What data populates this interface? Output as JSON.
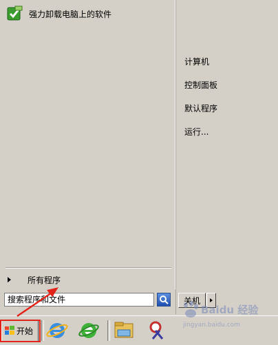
{
  "start_menu": {
    "pinned_items": [
      {
        "label": "强力卸载电脑上的软件",
        "icon": "uninstaller-app-icon"
      }
    ],
    "places": [
      {
        "label": "计算机"
      },
      {
        "label": "控制面板"
      },
      {
        "label": "默认程序"
      },
      {
        "label": "运行..."
      }
    ],
    "all_programs_label": "所有程序",
    "search": {
      "placeholder": "搜索程序和文件"
    },
    "shutdown_label": "关机"
  },
  "taskbar": {
    "start_label": "开始",
    "pinned_apps": [
      {
        "icon": "internet-explorer-icon"
      },
      {
        "icon": "green-browser-icon"
      },
      {
        "icon": "file-explorer-icon"
      },
      {
        "icon": "snipping-tool-icon"
      }
    ]
  },
  "annotation": {
    "highlight_color": "#e2231a"
  },
  "watermark": {
    "text": "Baidu 经验",
    "subtext": "jingyan.baidu.com"
  }
}
